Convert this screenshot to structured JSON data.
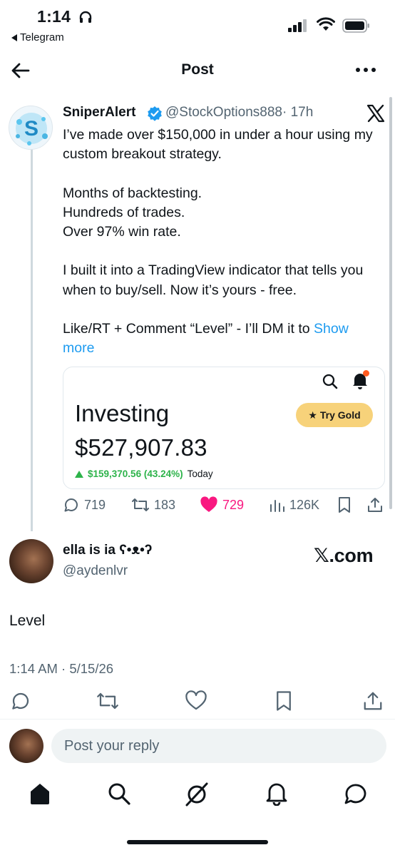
{
  "status_bar": {
    "time": "1:14",
    "back_app": "Telegram"
  },
  "header": {
    "title": "Post"
  },
  "quoted_post": {
    "name": "SniperAlert",
    "handle": "@StockOptions888",
    "time": "· 17h",
    "body": "I’ve made over $150,000 in under a hour using my custom breakout strategy.\n\nMonths of backtesting.\nHundreds of trades.\nOver 97% win rate.\n\nI built it into a TradingView indicator that tells you when to buy/sell. Now it’s yours - free.\n\nLike/RT + Comment  “Level” - I’ll DM it to ",
    "show_more": "Show more",
    "card": {
      "title": "Investing",
      "value": "$527,907.83",
      "gold_label": "Try Gold",
      "change": "$159,370.56 (43.24%)",
      "period": "Today"
    },
    "actions": {
      "replies": "719",
      "reposts": "183",
      "likes": "729",
      "views": "126K"
    }
  },
  "reply": {
    "name": "ella is ia ʕ•ᴥ•ʔ",
    "handle": "@aydenlvr",
    "site": "𝕏.com",
    "text": "Level",
    "timestamp": "1:14 AM · 5/15/26"
  },
  "composer": {
    "placeholder": "Post your reply"
  },
  "colors": {
    "accent": "#1d9bf0",
    "like": "#f91880",
    "gain": "#2db34a",
    "gold": "#f7d27a"
  },
  "icons": [
    "back-arrow-icon",
    "more-icon",
    "verified-icon",
    "x-logo-icon",
    "search-icon",
    "bell-icon",
    "reply-icon",
    "repost-icon",
    "heart-icon",
    "views-icon",
    "bookmark-icon",
    "share-icon",
    "home-icon",
    "grok-icon",
    "notifications-icon",
    "messages-icon"
  ]
}
